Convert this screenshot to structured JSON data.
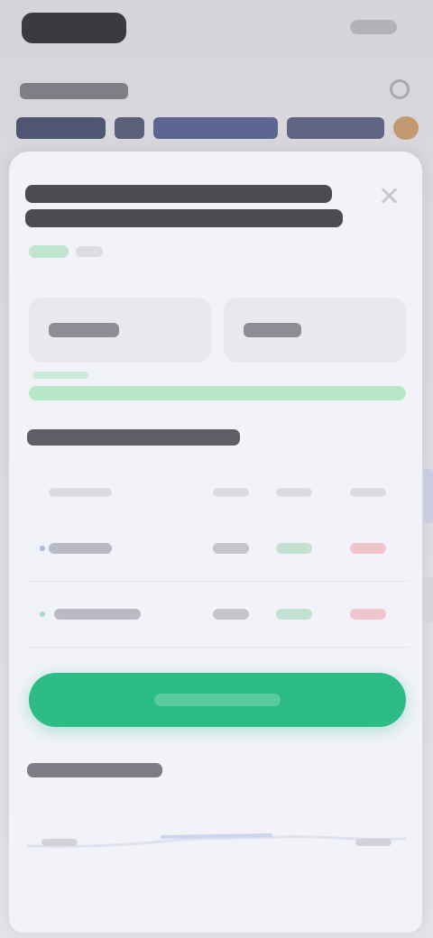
{
  "header": {
    "logo": "logo",
    "link": "",
    "subtitle": "",
    "ticker": [
      "",
      "",
      "",
      "",
      ""
    ]
  },
  "modal": {
    "title_lines": [
      "",
      ""
    ],
    "close_icon": "close-icon",
    "options": [
      {
        "label": ""
      },
      {
        "label": ""
      }
    ],
    "progress": {
      "label": "",
      "value": 1.0
    },
    "section_title": "",
    "table": {
      "headers": [
        "",
        "",
        "",
        ""
      ],
      "rows": [
        {
          "name": "",
          "v1": "",
          "v2": "",
          "v3": ""
        },
        {
          "name": "",
          "v1": "",
          "v2": "",
          "v3": ""
        }
      ]
    },
    "cta_label": "",
    "footer_title": "",
    "footer_axis": [
      "",
      ""
    ]
  },
  "colors": {
    "accent": "#2dbb86",
    "card_bg": "#f2f3f8",
    "negative": "#efc4cc",
    "positive": "#c3e1d1"
  }
}
